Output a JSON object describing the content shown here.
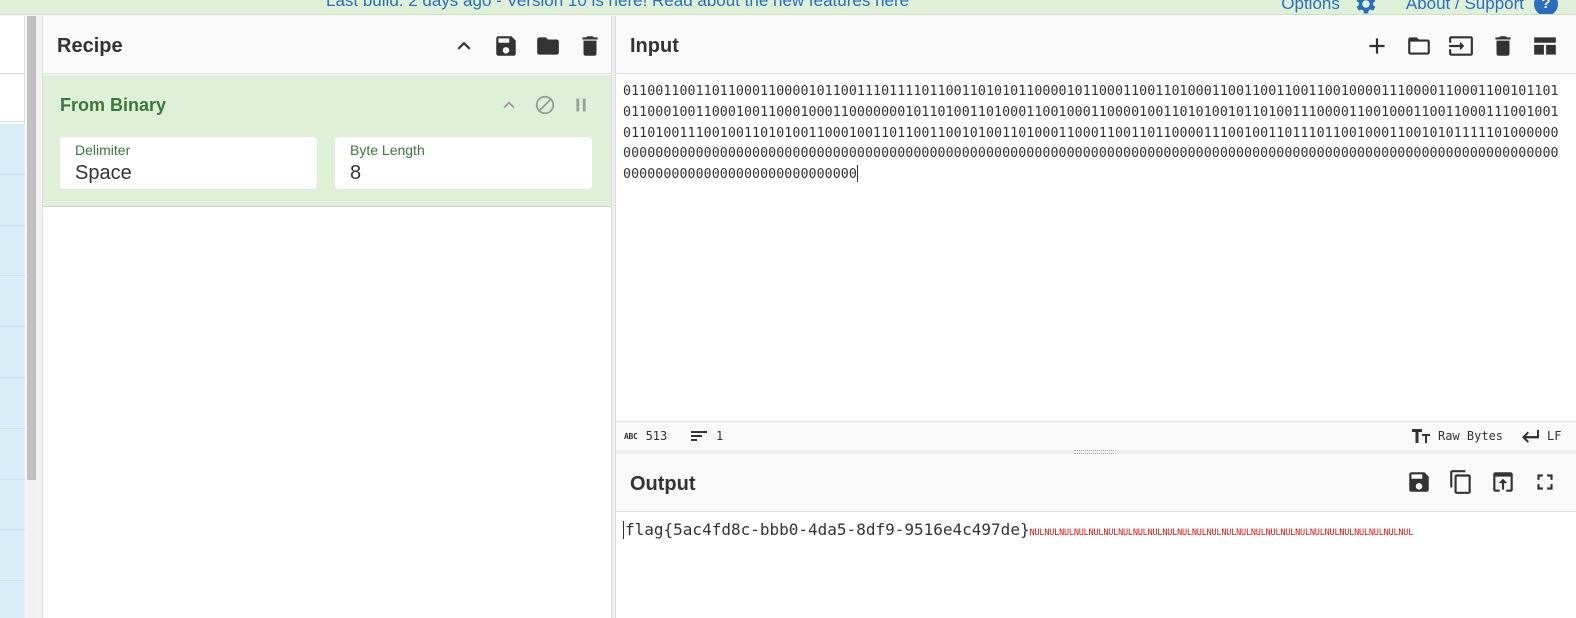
{
  "banner": {
    "text": "Last build: 2 days ago - Version 10 is here! Read about the new features here",
    "options_label": "Options",
    "about_label": "About / Support",
    "help_glyph": "?"
  },
  "recipe": {
    "title": "Recipe",
    "operation": {
      "name": "From Binary",
      "args": [
        {
          "label": "Delimiter",
          "value": "Space"
        },
        {
          "label": "Byte Length",
          "value": "8"
        }
      ]
    }
  },
  "input": {
    "title": "Input",
    "text": "0110011001101100011000010110011101111011001101010110000101100011001101000110011001100110010000111000011000110010110101100010011000100110001000110000000101101001101000110010001100001001101010010110100111000011001000110011000111001001011010011100100110101001100010011011001100101001101000110001100110110000111001001101110110010001100101011111010000000000000000000000000000000000000000000000000000000000000000000000000000000000000000000000000000000000000000000000000000000000000000000000000000000",
    "status": {
      "length_icon": "ABC",
      "length": "513",
      "lines": "1",
      "encoding": "Raw Bytes",
      "eol": "LF"
    }
  },
  "output": {
    "title": "Output",
    "text": "flag{5ac4fd8c-bbb0-4da5-8df9-9516e4c497de}",
    "nul_text": "NULNULNULNULNULNULNULNULNULNULNULNULNULNULNULNULNULNULNULNULNULNULNULNULNULNUL"
  },
  "icons": {
    "recipe_head": [
      "chevron-up-icon",
      "save-icon",
      "folder-icon",
      "trash-icon"
    ],
    "op_controls": [
      "chevron-up-icon",
      "disable-icon",
      "pause-icon"
    ],
    "input_head": [
      "plus-icon",
      "folder-icon",
      "input-file-icon",
      "trash-icon",
      "layout-icon"
    ],
    "output_head": [
      "save-icon",
      "copy-icon",
      "replace-input-icon",
      "maximize-icon"
    ]
  },
  "colors": {
    "op_bg": "#dff0d8",
    "op_text": "#3c763d",
    "link": "#2a6ebb",
    "nul": "#e01515"
  }
}
